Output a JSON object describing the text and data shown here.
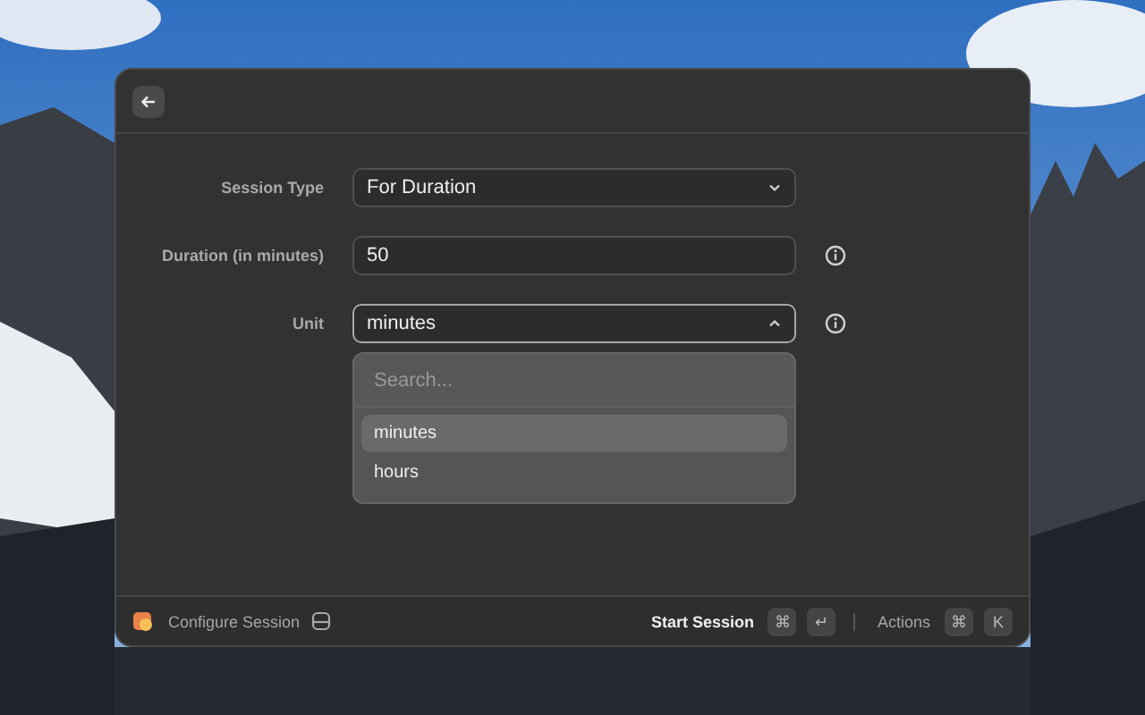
{
  "form": {
    "fields": [
      {
        "kind": "select",
        "label": "Session Type",
        "value": "For Duration",
        "expanded": false,
        "info": false
      },
      {
        "kind": "text",
        "label": "Duration (in minutes)",
        "value": "50",
        "info": true
      },
      {
        "kind": "select",
        "label": "Unit",
        "value": "minutes",
        "expanded": true,
        "info": true
      }
    ]
  },
  "dropdown": {
    "placeholder": "Search...",
    "options": [
      {
        "label": "minutes",
        "selected": true
      },
      {
        "label": "hours",
        "selected": false
      }
    ]
  },
  "footer": {
    "title": "Configure Session",
    "primary_action": {
      "label": "Start Session",
      "keys": [
        "⌘",
        "↵"
      ]
    },
    "actions": {
      "label": "Actions",
      "keys": [
        "⌘",
        "K"
      ]
    }
  }
}
